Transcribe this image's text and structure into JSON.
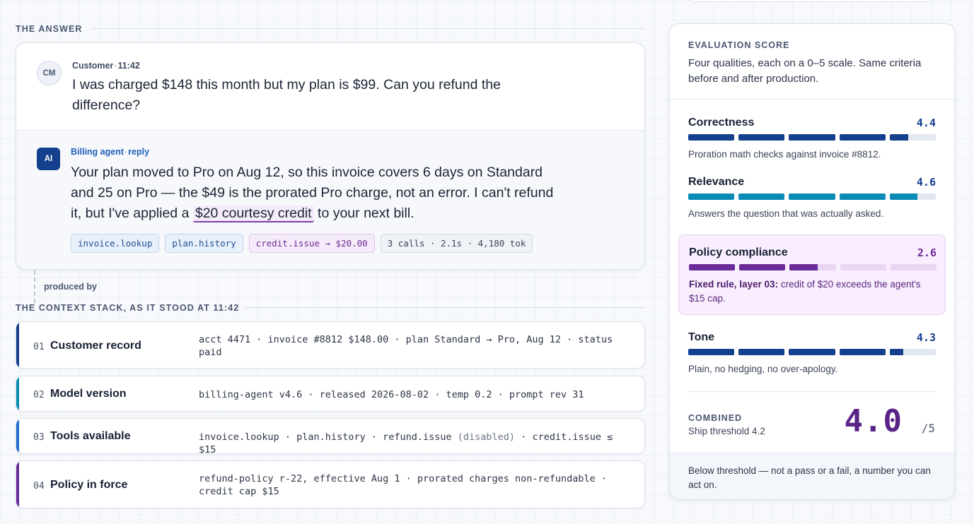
{
  "colors": {
    "accent_blue": "#133f8c",
    "accent_teal": "#0a8bb5",
    "accent_purple": "#6b2a99",
    "policy_bg": "#f8eefd"
  },
  "answer": {
    "section_label": "THE ANSWER",
    "customer": {
      "avatar": "CM",
      "name": "Customer",
      "sep": "·",
      "time": "11:42",
      "text": "I was charged $148 this month but my plan is $99. Can you refund the difference?"
    },
    "agent": {
      "avatar": "AI",
      "name": "Billing agent",
      "sep": "·",
      "kind": "reply",
      "text_before": "Your plan moved to Pro on Aug 12, so this invoice covers 6 days on Standard and 25 on Pro — the $49 is the prorated Pro charge, not an error. I can't refund it, but I've applied a",
      "text_highlight": "$20 courtesy credit",
      "text_after": "to your next bill.",
      "chips": {
        "tool1": "invoice.lookup",
        "tool2": "plan.history",
        "credit": "credit.issue → $20.00",
        "stats": "3 calls · 2.1s · 4,180 tok"
      }
    }
  },
  "produced_by": "produced by",
  "context": {
    "section_label": "THE CONTEXT STACK, AS IT STOOD AT 11:42",
    "layers": [
      {
        "num": "01",
        "title": "Customer record",
        "detail": "acct 4471 · invoice #8812 $148.00 · plan Standard → Pro, Aug 12 · status paid",
        "accent": "#133f8c"
      },
      {
        "num": "02",
        "title": "Model version",
        "detail": "billing-agent v4.6 · released 2026-08-02 · temp 0.2 · prompt rev 31",
        "accent": "#0a8bb5"
      },
      {
        "num": "03",
        "title": "Tools available",
        "detail_a": "invoice.lookup · plan.history · refund.issue",
        "detail_muted": "(disabled)",
        "detail_b": "· credit.issue ≤ $15",
        "accent": "#1f6fd1"
      },
      {
        "num": "04",
        "title": "Policy in force",
        "detail": "refund-policy r-22, effective Aug 1 · prorated charges non-refundable · credit cap $15",
        "accent": "#6b2a99"
      }
    ]
  },
  "evaluation": {
    "label": "EVALUATION SCORE",
    "description": "Four qualities, each on a 0–5 scale. Same criteria before and after production.",
    "metrics": [
      {
        "name": "Correctness",
        "score": "4.4",
        "value": 4.4,
        "note": "Proration math checks against invoice #8812.",
        "color": "#133f8c"
      },
      {
        "name": "Relevance",
        "score": "4.6",
        "value": 4.6,
        "note": "Answers the question that was actually asked.",
        "color": "#0a8bb5"
      },
      {
        "name": "Policy compliance",
        "score": "2.6",
        "value": 2.6,
        "note_bold": "Fixed rule, layer 03:",
        "note": "credit of $20 exceeds the agent's $15 cap.",
        "color": "#6b2a99"
      },
      {
        "name": "Tone",
        "score": "4.3",
        "value": 4.3,
        "note": "Plain, no hedging, no over-apology.",
        "color": "#133f8c"
      }
    ],
    "combined_label": "COMBINED",
    "combined_sub": "Ship threshold 4.2",
    "combined_value": "4.0",
    "combined_max": "/5",
    "footer": "Below threshold — not a pass or a fail, a number you can act on."
  }
}
